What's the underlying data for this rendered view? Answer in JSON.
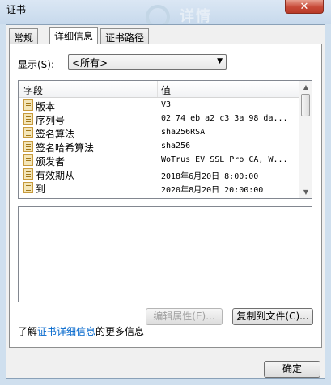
{
  "window": {
    "title": "证书",
    "close_glyph": "✕"
  },
  "watermark": {
    "text": "详情"
  },
  "tabs": [
    {
      "label": "常规",
      "active": false
    },
    {
      "label": "详细信息",
      "active": true
    },
    {
      "label": "证书路径",
      "active": false
    }
  ],
  "show": {
    "label": "显示(S):",
    "selected": "<所有>"
  },
  "list": {
    "headers": {
      "field": "字段",
      "value": "值"
    },
    "rows": [
      {
        "field": "版本",
        "value": "V3"
      },
      {
        "field": "序列号",
        "value": "02 74 eb a2 c3 3a 98 da..."
      },
      {
        "field": "签名算法",
        "value": "sha256RSA"
      },
      {
        "field": "签名哈希算法",
        "value": "sha256"
      },
      {
        "field": "颁发者",
        "value": "WoTrus EV SSL Pro CA, W..."
      },
      {
        "field": "有效期从",
        "value": "2018年6月20日 8:00:00"
      },
      {
        "field": "到",
        "value": "2020年8月20日 20:00:00"
      }
    ]
  },
  "buttons": {
    "edit_properties": "编辑属性(E)...",
    "copy_to_file": "复制到文件(C)...",
    "ok": "确定"
  },
  "learn_more": {
    "prefix": "了解",
    "link": "证书详细信息",
    "suffix": "的更多信息"
  },
  "icons": {
    "row_icon": "certificate-field-icon",
    "dropdown": "chevron-down-icon",
    "scroll_up": "scroll-up-icon",
    "scroll_down": "scroll-down-icon"
  }
}
